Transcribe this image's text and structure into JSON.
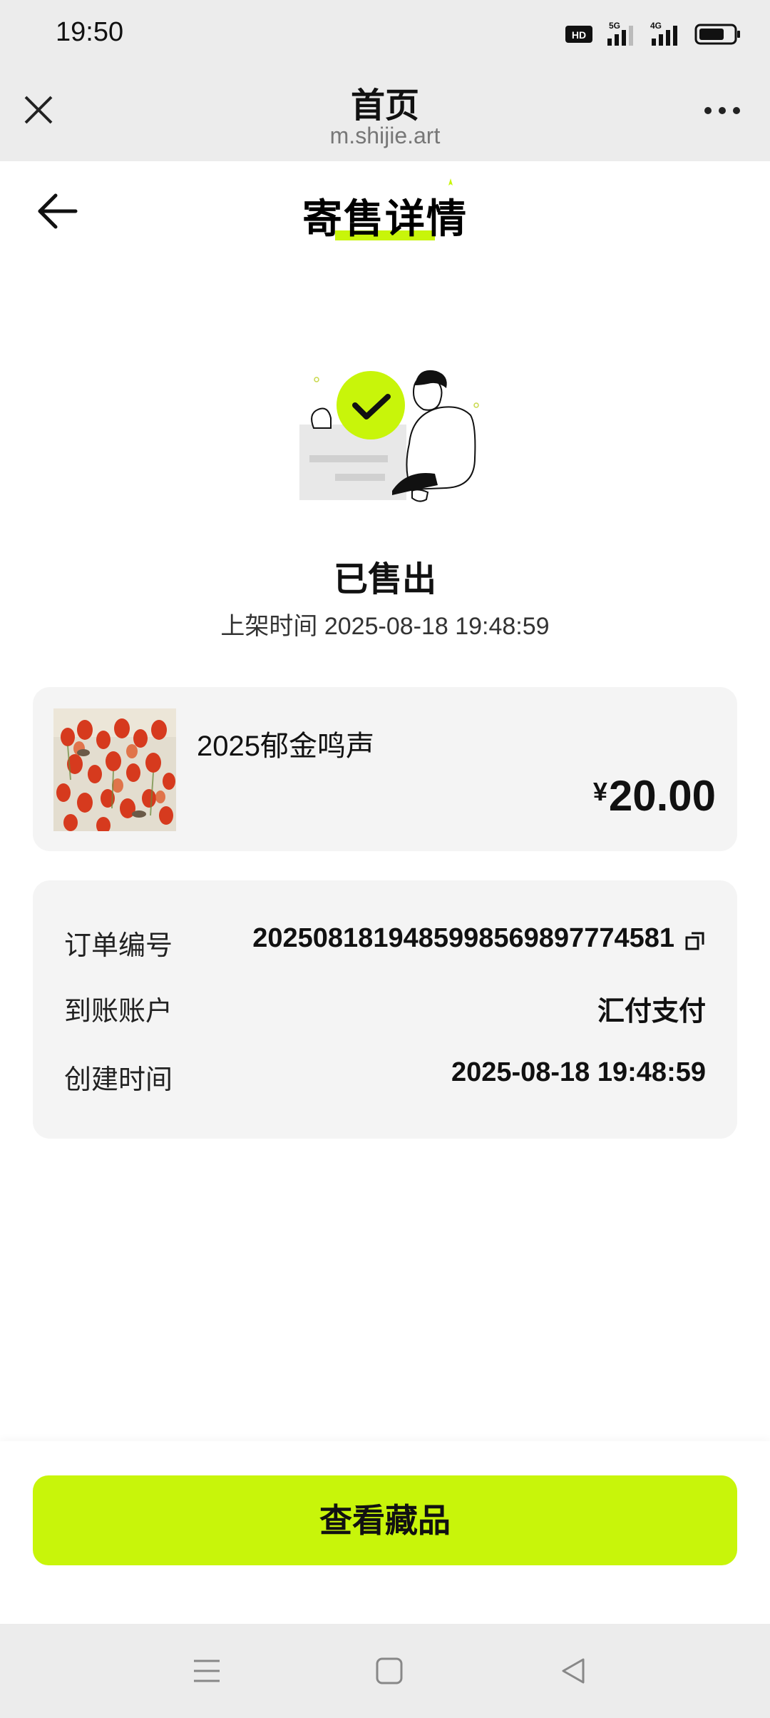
{
  "status_bar": {
    "time": "19:50",
    "hd_label": "HD",
    "net1": "5G",
    "net2": "4G"
  },
  "browser": {
    "title": "首页",
    "url": "m.shijie.art"
  },
  "header": {
    "title": "寄售详情"
  },
  "status": {
    "title": "已售出",
    "listed_label": "上架时间",
    "listed_time": "2025-08-18 19:48:59"
  },
  "product": {
    "name": "2025郁金鸣声",
    "currency": "¥",
    "price": "20.00"
  },
  "order_info": {
    "order_no_label": "订单编号",
    "order_no": "20250818194859985698977745​81",
    "account_label": "到账账户",
    "account": "汇付支付",
    "created_label": "创建时间",
    "created_time": "2025-08-18 19:48:59"
  },
  "actions": {
    "view_collection": "查看藏品"
  },
  "colors": {
    "accent": "#c8f50a",
    "card_bg": "#f4f4f4",
    "chrome_bg": "#ececec"
  }
}
